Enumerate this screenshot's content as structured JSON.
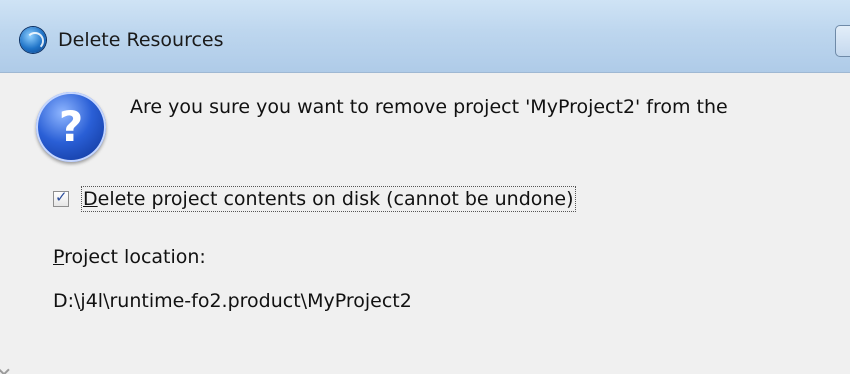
{
  "window": {
    "title": "Delete Resources",
    "title_icon": "eclipse-icon"
  },
  "dialog": {
    "icon": "question-icon",
    "message": "Are you sure you want to remove project 'MyProject2' from the",
    "checkbox": {
      "label": "Delete project contents on disk (cannot be undone)",
      "checked": true
    },
    "location_label": "Project location:",
    "location_value": "D:\\j4l\\runtime-fo2.product\\MyProject2"
  },
  "colors": {
    "titlebar": "#bdd6ee",
    "background": "#f0f0f0",
    "question_icon": "#2a5fd6"
  }
}
